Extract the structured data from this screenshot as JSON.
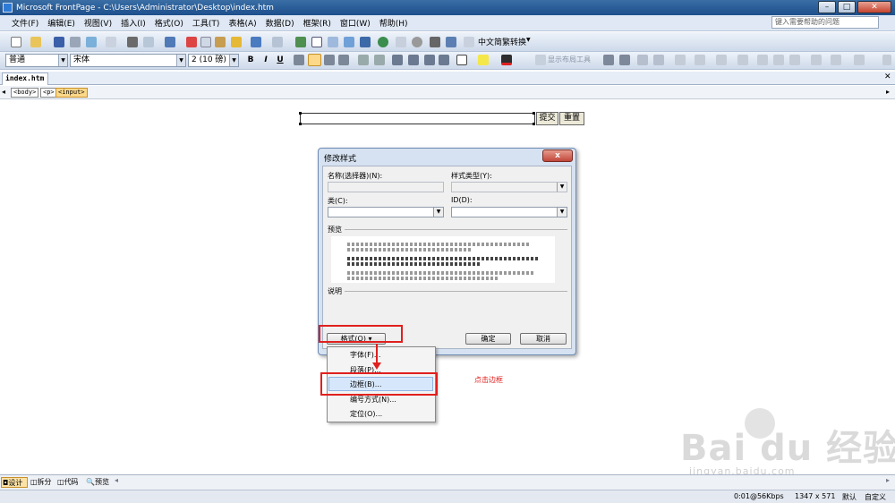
{
  "window": {
    "title": "Microsoft FrontPage - C:\\Users\\Administrator\\Desktop\\index.htm",
    "minimize": "–",
    "maximize": "□",
    "close": "✕"
  },
  "menubar": {
    "items": [
      "文件(F)",
      "编辑(E)",
      "视图(V)",
      "插入(I)",
      "格式(O)",
      "工具(T)",
      "表格(A)",
      "数据(D)",
      "框架(R)",
      "窗口(W)",
      "帮助(H)"
    ],
    "help_placeholder": "键入需要帮助的问题"
  },
  "toolbar": {
    "convert_label": "中文简繁转换",
    "layout_label": "显示布局工具",
    "style": "普通",
    "font": "宋体",
    "size": "2 (10 磅)",
    "bold": "B",
    "italic": "I",
    "underline": "U"
  },
  "tabs": {
    "doc": "index.htm",
    "body_tag": "<body>",
    "p_tag": "<p>",
    "input_tag": "<input>"
  },
  "form": {
    "submit": "提交",
    "reset": "重置"
  },
  "dialog": {
    "title": "修改样式",
    "close": "x",
    "name_label": "名称(选择器)(N):",
    "type_label": "样式类型(Y):",
    "class_label": "类(C):",
    "id_label": "ID(D):",
    "preview_label": "预览",
    "desc_label": "说明",
    "format_button": "格式(O) ▾",
    "ok": "确定",
    "cancel": "取消"
  },
  "format_menu": {
    "items": [
      "字体(F)...",
      "段落(P)...",
      "边框(B)...",
      "编号方式(N)...",
      "定位(O)..."
    ],
    "highlighted_index": 2
  },
  "annotation": {
    "note": "点击边框"
  },
  "watermark": {
    "brand": "Bai  du 经验",
    "url": "jingyan.baidu.com"
  },
  "view_tabs": [
    "设计",
    "拆分",
    "代码",
    "预览"
  ],
  "statusbar": {
    "speed": "0:01@56Kbps",
    "dims": "1347 x 571",
    "mode1": "默认",
    "mode2": "自定义"
  },
  "colors": {
    "titlebar": "#1d4f8c",
    "highlight_red": "#e0201e"
  }
}
